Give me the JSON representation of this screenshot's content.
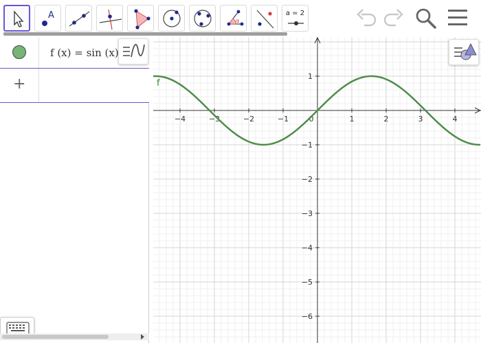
{
  "toolbar": {
    "tools": [
      {
        "name": "move-tool",
        "selected": true
      },
      {
        "name": "point-tool",
        "label": "A"
      },
      {
        "name": "line-tool"
      },
      {
        "name": "perpendicular-line-tool"
      },
      {
        "name": "polygon-tool"
      },
      {
        "name": "circle-center-point-tool"
      },
      {
        "name": "circle-three-points-tool"
      },
      {
        "name": "angle-tool"
      },
      {
        "name": "reflect-tool"
      },
      {
        "name": "slider-tool",
        "label": "a = 2"
      }
    ],
    "right_buttons": [
      "undo-icon",
      "redo-icon",
      "search-icon",
      "menu-icon"
    ]
  },
  "algebra": {
    "entries": [
      {
        "formula": "f (x)  =  sin (x)",
        "color": "#77b575"
      }
    ],
    "input_icon": "+"
  },
  "graph": {
    "function_label": "f",
    "curve_color": "#4e8c4a",
    "x_ticks": [
      "−4",
      "−3",
      "−2",
      "−1",
      "0",
      "1",
      "2",
      "3",
      "4"
    ],
    "y_ticks_pos": [
      "1"
    ],
    "y_ticks_neg": [
      "−1",
      "−2",
      "−3",
      "−4",
      "−5",
      "−6"
    ]
  }
}
